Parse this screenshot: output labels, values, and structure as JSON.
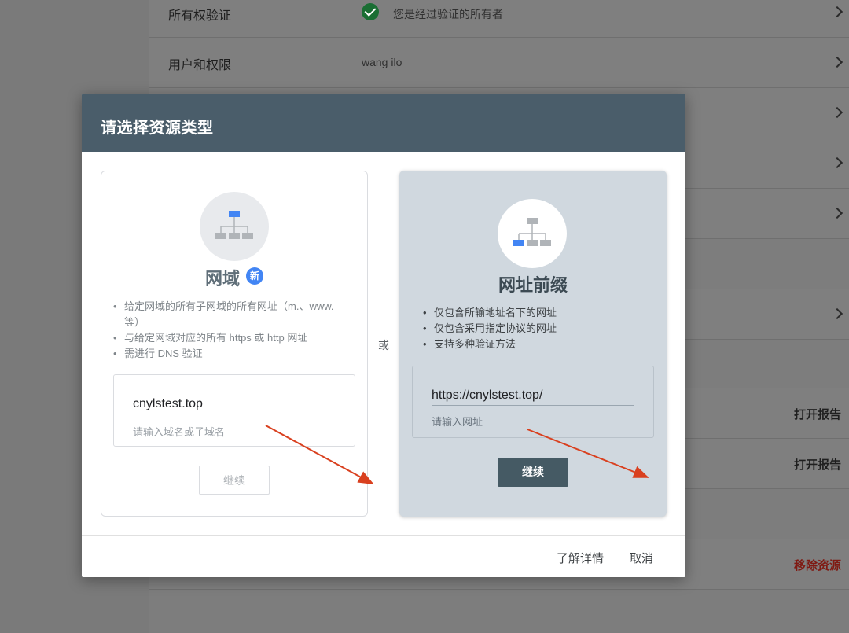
{
  "background": {
    "rows": [
      {
        "label": "所有权验证",
        "value": "您是经过验证的所有者"
      },
      {
        "label": "用户和权限",
        "value": "wang ilo"
      }
    ],
    "actions": {
      "open_report_1": "打开报告",
      "open_report_2": "打开报告",
      "remove_resource": "移除资源"
    }
  },
  "dialog": {
    "title": "请选择资源类型",
    "or_label": "或",
    "learn_more": "了解详情",
    "cancel": "取消",
    "domain_card": {
      "title": "网域",
      "badge": "新",
      "bullets": [
        "给定网域的所有子网域的所有网址（m.、www. 等）",
        "与给定网域对应的所有 https 或 http 网址",
        "需进行 DNS 验证"
      ],
      "input_value": "cnylstest.top",
      "input_hint": "请输入域名或子域名",
      "button": "继续"
    },
    "prefix_card": {
      "title": "网址前缀",
      "bullets": [
        "仅包含所输地址名下的网址",
        "仅包含采用指定协议的网址",
        "支持多种验证方法"
      ],
      "input_value": "https://cnylstest.top/",
      "input_hint": "请输入网址",
      "button": "继续"
    }
  },
  "colors": {
    "header": "#4a5d6a",
    "accent_blue": "#4285f4",
    "arrow": "#d9401f",
    "prefix_card": "#d0d8df"
  }
}
